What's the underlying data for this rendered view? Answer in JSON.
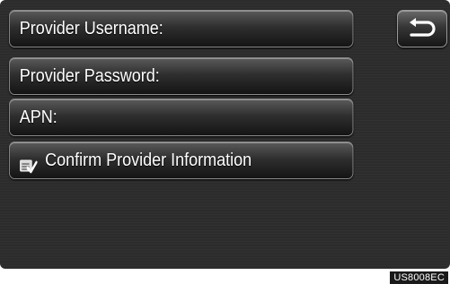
{
  "menu": {
    "items": [
      {
        "label": "Provider Username:"
      },
      {
        "label": "Provider Password:"
      },
      {
        "label": "APN:"
      },
      {
        "label": "Confirm Provider Information",
        "icon": "confirm-info-icon"
      }
    ]
  },
  "back_button": {
    "icon": "back-arrow-icon"
  },
  "caption": "US8008EC"
}
